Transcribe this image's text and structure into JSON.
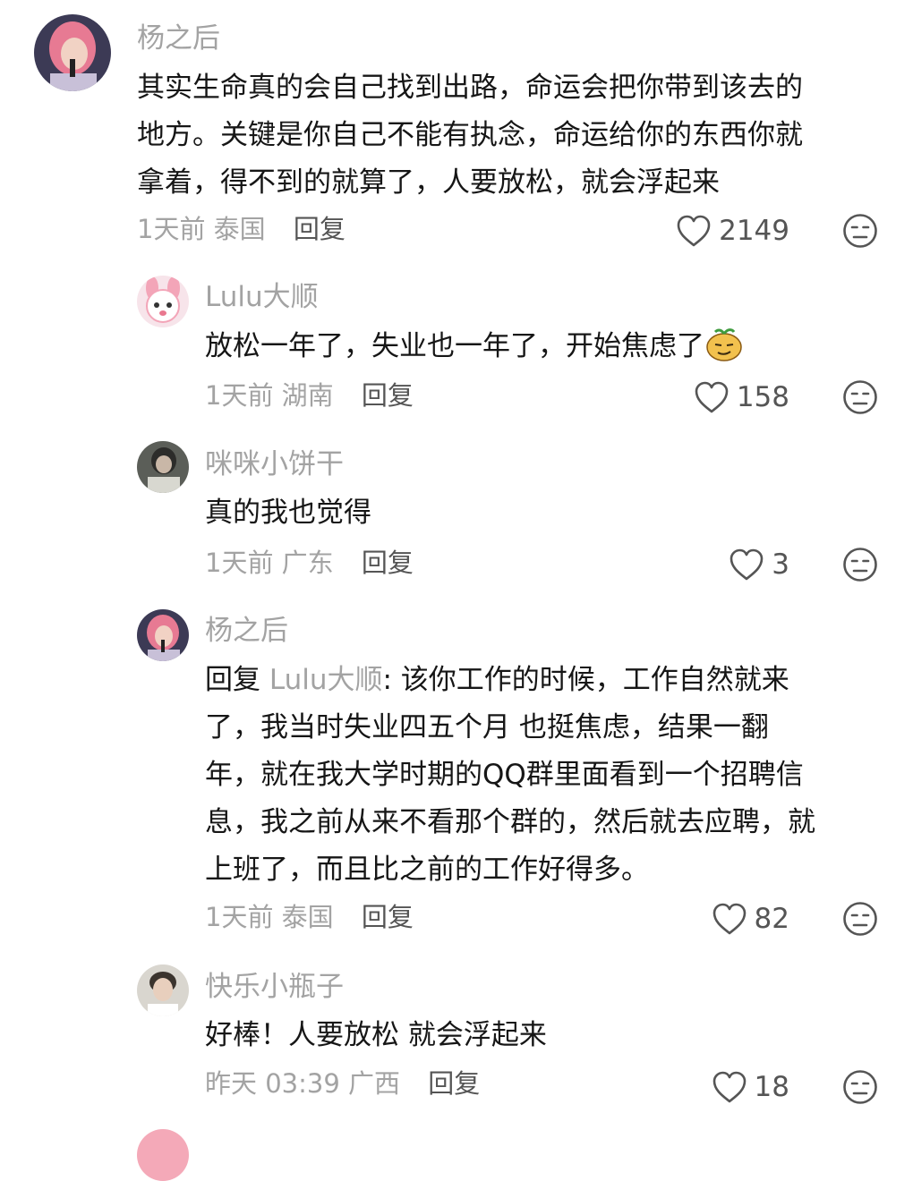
{
  "comments": [
    {
      "username": "杨之后",
      "lines": [
        "其实生命真的会自己找到出路，命运会把你带到该去的",
        "地方。关键是你自己不能有执念，命运给你的东西你就",
        "拿着，得不到的就算了，人要放松，就会浮起来"
      ],
      "time": "1天前",
      "location": "泰国",
      "reply_label": "回复",
      "likes": "2149",
      "avatar": "pink-hair-singer-avatar"
    },
    {
      "username": "Lulu大顺",
      "text": "放松一年了，失业也一年了，开始焦虑了",
      "emoji": "smirk-fruit-emoji",
      "time": "1天前",
      "location": "湖南",
      "reply_label": "回复",
      "likes": "158",
      "avatar": "pink-bunny-avatar"
    },
    {
      "username": "咪咪小饼干",
      "text": "真的我也觉得",
      "time": "1天前",
      "location": "广东",
      "reply_label": "回复",
      "likes": "3",
      "avatar": "dark-photo-avatar"
    },
    {
      "username": "杨之后",
      "reply_prefix": "回复",
      "reply_target": "Lulu大顺",
      "line1_rest": ": 该你工作的时候，工作自然就来",
      "lines": [
        "了，我当时失业四五个月 也挺焦虑，结果一翻",
        "年，就在我大学时期的QQ群里面看到一个招聘信",
        "息，我之前从来不看那个群的，然后就去应聘，就",
        "上班了，而且比之前的工作好得多。"
      ],
      "time": "1天前",
      "location": "泰国",
      "reply_label": "回复",
      "likes": "82",
      "avatar": "pink-hair-singer-avatar"
    },
    {
      "username": "快乐小瓶子",
      "text": "好棒！人要放松 就会浮起来",
      "time": "昨天 03:39",
      "location": "广西",
      "reply_label": "回复",
      "likes": "18",
      "avatar": "young-man-avatar"
    }
  ],
  "icons": {
    "like": "heart-outline-icon",
    "dislike": "neutral-face-icon"
  },
  "colors": {
    "muted": "#a3a3a3",
    "text": "#161616",
    "icon": "#555555"
  }
}
